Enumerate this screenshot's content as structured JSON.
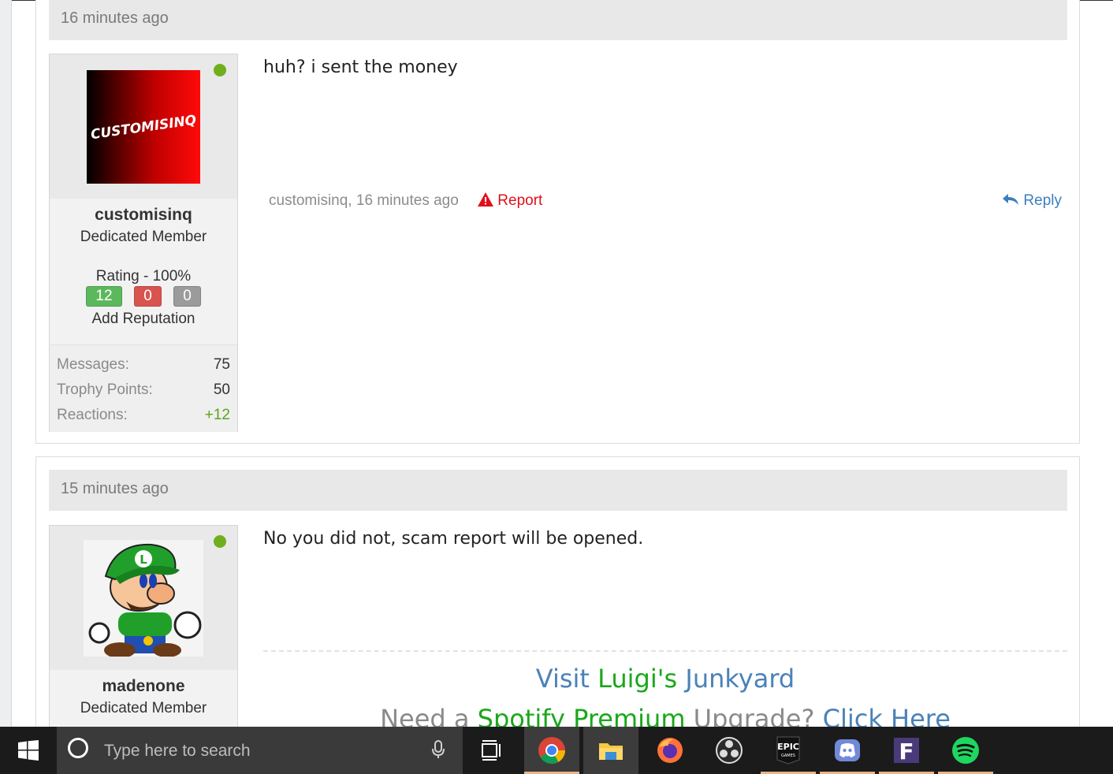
{
  "posts": [
    {
      "time": "16 minutes ago",
      "username": "customisinq",
      "avatar_text": "CUSTOMISINQ",
      "user_title": "Dedicated Member",
      "rating_label": "Rating - 100%",
      "rep": {
        "positive": "12",
        "negative": "0",
        "neutral": "0"
      },
      "add_reputation": "Add Reputation",
      "stats": [
        {
          "label": "Messages:",
          "value": "75"
        },
        {
          "label": "Trophy Points:",
          "value": "50"
        },
        {
          "label": "Reactions:",
          "value": "+12"
        }
      ],
      "message": "huh? i sent the money",
      "meta": "customisinq, 16 minutes ago",
      "report_label": "Report",
      "reply_label": "Reply"
    },
    {
      "time": "15 minutes ago",
      "username": "madenone",
      "user_title": "Dedicated Member",
      "message": "No you did not, scam report will be opened.",
      "signature": {
        "line1_prefix": "Visit ",
        "line1_green": "Luigi's",
        "line1_suffix": " Junkyard",
        "line2_prefix": "Need a ",
        "line2_green": "Spotify Premium",
        "line2_mid": " Upgrade? ",
        "line2_link": "Click Here"
      }
    }
  ],
  "taskbar": {
    "search_placeholder": "Type here to search",
    "icons": [
      "windows-start-icon",
      "cortana-icon",
      "microphone-icon",
      "task-view-icon",
      "chrome-icon",
      "file-explorer-icon",
      "firefox-icon",
      "obs-icon",
      "epic-games-icon",
      "discord-icon",
      "fortnite-icon",
      "spotify-icon"
    ],
    "epic_text": "EPIC",
    "epic_sub": "GAMES",
    "fortnite_letter": "F"
  },
  "colors": {
    "online": "#6faf1e",
    "positive": "#5cb85c",
    "negative": "#d9534f",
    "neutral": "#999999",
    "report": "#e0101a",
    "link": "#3d7fbf"
  }
}
